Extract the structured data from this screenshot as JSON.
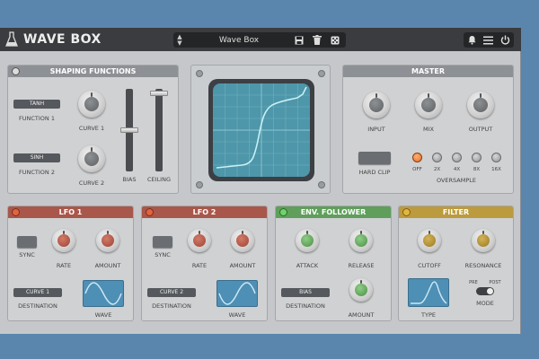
{
  "app": {
    "title": "WAVE BOX"
  },
  "preset": {
    "name": "Wave Box"
  },
  "shaping": {
    "title": "SHAPING FUNCTIONS",
    "function1_value": "TANH",
    "function1_label": "FUNCTION 1",
    "function2_value": "SINH",
    "function2_label": "FUNCTION 2",
    "curve1_label": "CURVE 1",
    "curve2_label": "CURVE 2",
    "bias_label": "BIAS",
    "ceiling_label": "CEILING"
  },
  "master": {
    "title": "MASTER",
    "input_label": "INPUT",
    "mix_label": "MIX",
    "output_label": "OUTPUT",
    "hardclip_label": "HARD CLIP",
    "oversample_label": "OVERSAMPLE",
    "oversample_options": [
      "OFF",
      "2X",
      "4X",
      "8X",
      "16X"
    ]
  },
  "lfo1": {
    "title": "LFO 1",
    "sync_label": "SYNC",
    "rate_label": "RATE",
    "amount_label": "AMOUNT",
    "destination_value": "CURVE 1",
    "destination_label": "DESTINATION",
    "wave_label": "WAVE"
  },
  "lfo2": {
    "title": "LFO 2",
    "sync_label": "SYNC",
    "rate_label": "RATE",
    "amount_label": "AMOUNT",
    "destination_value": "CURVE 2",
    "destination_label": "DESTINATION",
    "wave_label": "WAVE"
  },
  "env": {
    "title": "ENV. FOLLOWER",
    "attack_label": "ATTACK",
    "release_label": "RELEASE",
    "destination_value": "BIAS",
    "destination_label": "DESTINATION",
    "amount_label": "AMOUNT"
  },
  "filter": {
    "title": "FILTER",
    "cutoff_label": "CUTOFF",
    "resonance_label": "RESONANCE",
    "type_label": "TYPE",
    "mode_label": "MODE",
    "pre_label": "PRE",
    "post_label": "POST"
  },
  "colors": {
    "lfo": "#a9574a",
    "env": "#5f9f5b",
    "filter": "#bc9b3e",
    "accent": "#e36f2c"
  }
}
